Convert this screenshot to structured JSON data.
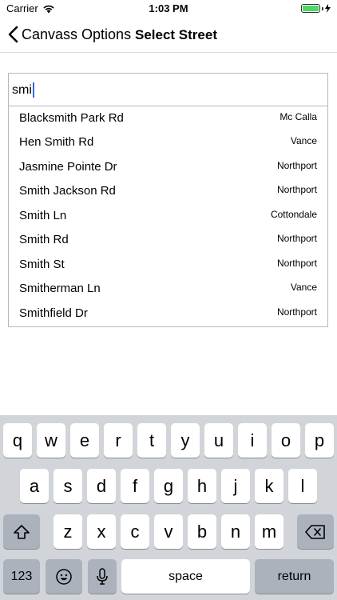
{
  "status_bar": {
    "carrier": "Carrier",
    "time": "1:03 PM"
  },
  "nav": {
    "back_label": "Canvass Options",
    "title": "Select Street"
  },
  "search": {
    "value": "smi"
  },
  "suggestions": [
    {
      "name": "Blacksmith Park Rd",
      "city": "Mc Calla"
    },
    {
      "name": "Hen Smith Rd",
      "city": "Vance"
    },
    {
      "name": "Jasmine Pointe Dr",
      "city": "Northport"
    },
    {
      "name": "Smith Jackson Rd",
      "city": "Northport"
    },
    {
      "name": "Smith Ln",
      "city": "Cottondale"
    },
    {
      "name": "Smith Rd",
      "city": "Northport"
    },
    {
      "name": "Smith St",
      "city": "Northport"
    },
    {
      "name": "Smitherman Ln",
      "city": "Vance"
    },
    {
      "name": "Smithfield Dr",
      "city": "Northport"
    }
  ],
  "keyboard": {
    "row1": [
      "q",
      "w",
      "e",
      "r",
      "t",
      "y",
      "u",
      "i",
      "o",
      "p"
    ],
    "row2": [
      "a",
      "s",
      "d",
      "f",
      "g",
      "h",
      "j",
      "k",
      "l"
    ],
    "row3": [
      "z",
      "x",
      "c",
      "v",
      "b",
      "n",
      "m"
    ],
    "numbers_label": "123",
    "space_label": "space",
    "return_label": "return"
  },
  "colors": {
    "caret": "#2f6de1",
    "battery": "#4cd964",
    "keyboard_bg": "#d1d4d9"
  },
  "icons": [
    "wifi-icon",
    "battery-icon",
    "charging-icon",
    "back-chevron-icon",
    "shift-icon",
    "delete-icon",
    "emoji-icon",
    "microphone-icon"
  ]
}
